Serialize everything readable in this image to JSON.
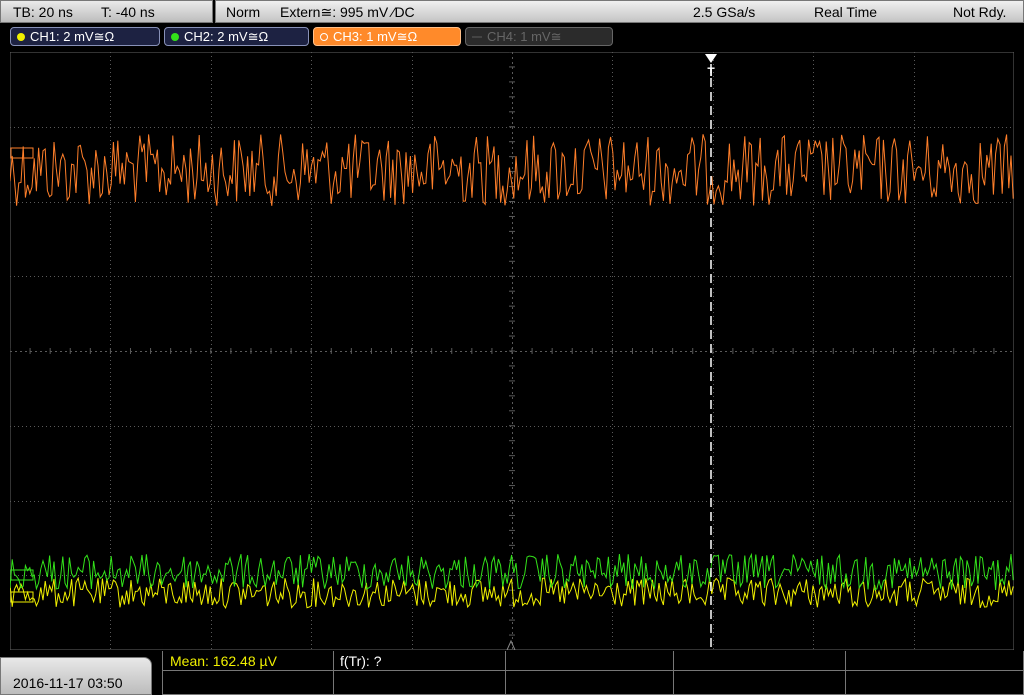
{
  "timebase": {
    "tb": "TB: 20 ns",
    "trigger_time": "T: -40 ns"
  },
  "trigger_bar": {
    "mode": "Norm",
    "source": "Extern≅: 995 mV ⁄DC",
    "sample_rate": "2.5 GSa/s",
    "acq_mode": "Real Time",
    "status": "Not Rdy."
  },
  "channels": [
    {
      "label": "CH1: 2 mV≅Ω",
      "color": "#f0f000"
    },
    {
      "label": "CH2: 2 mV≅Ω",
      "color": "#33e21a"
    },
    {
      "label": "CH3: 1 mV≅Ω",
      "color": "#ff7f2a"
    },
    {
      "label": "CH4: 1 mV≅",
      "color": "#5a5a5a"
    }
  ],
  "trigger_marker": "T",
  "bottom": {
    "datetime": "2016-11-17 03:50",
    "measurement1": "Mean: 162.48 µV",
    "measurement2": "f(Tr): ?"
  },
  "colors": {
    "grid": "#5a5a5a",
    "measurement_text": "#f0f000"
  },
  "icons": [
    "trigger-position-icon",
    "ground-ref-ch3-icon",
    "ground-ref-ch1-icon",
    "ground-ref-ch2-icon",
    "trigger-level-icon"
  ]
}
